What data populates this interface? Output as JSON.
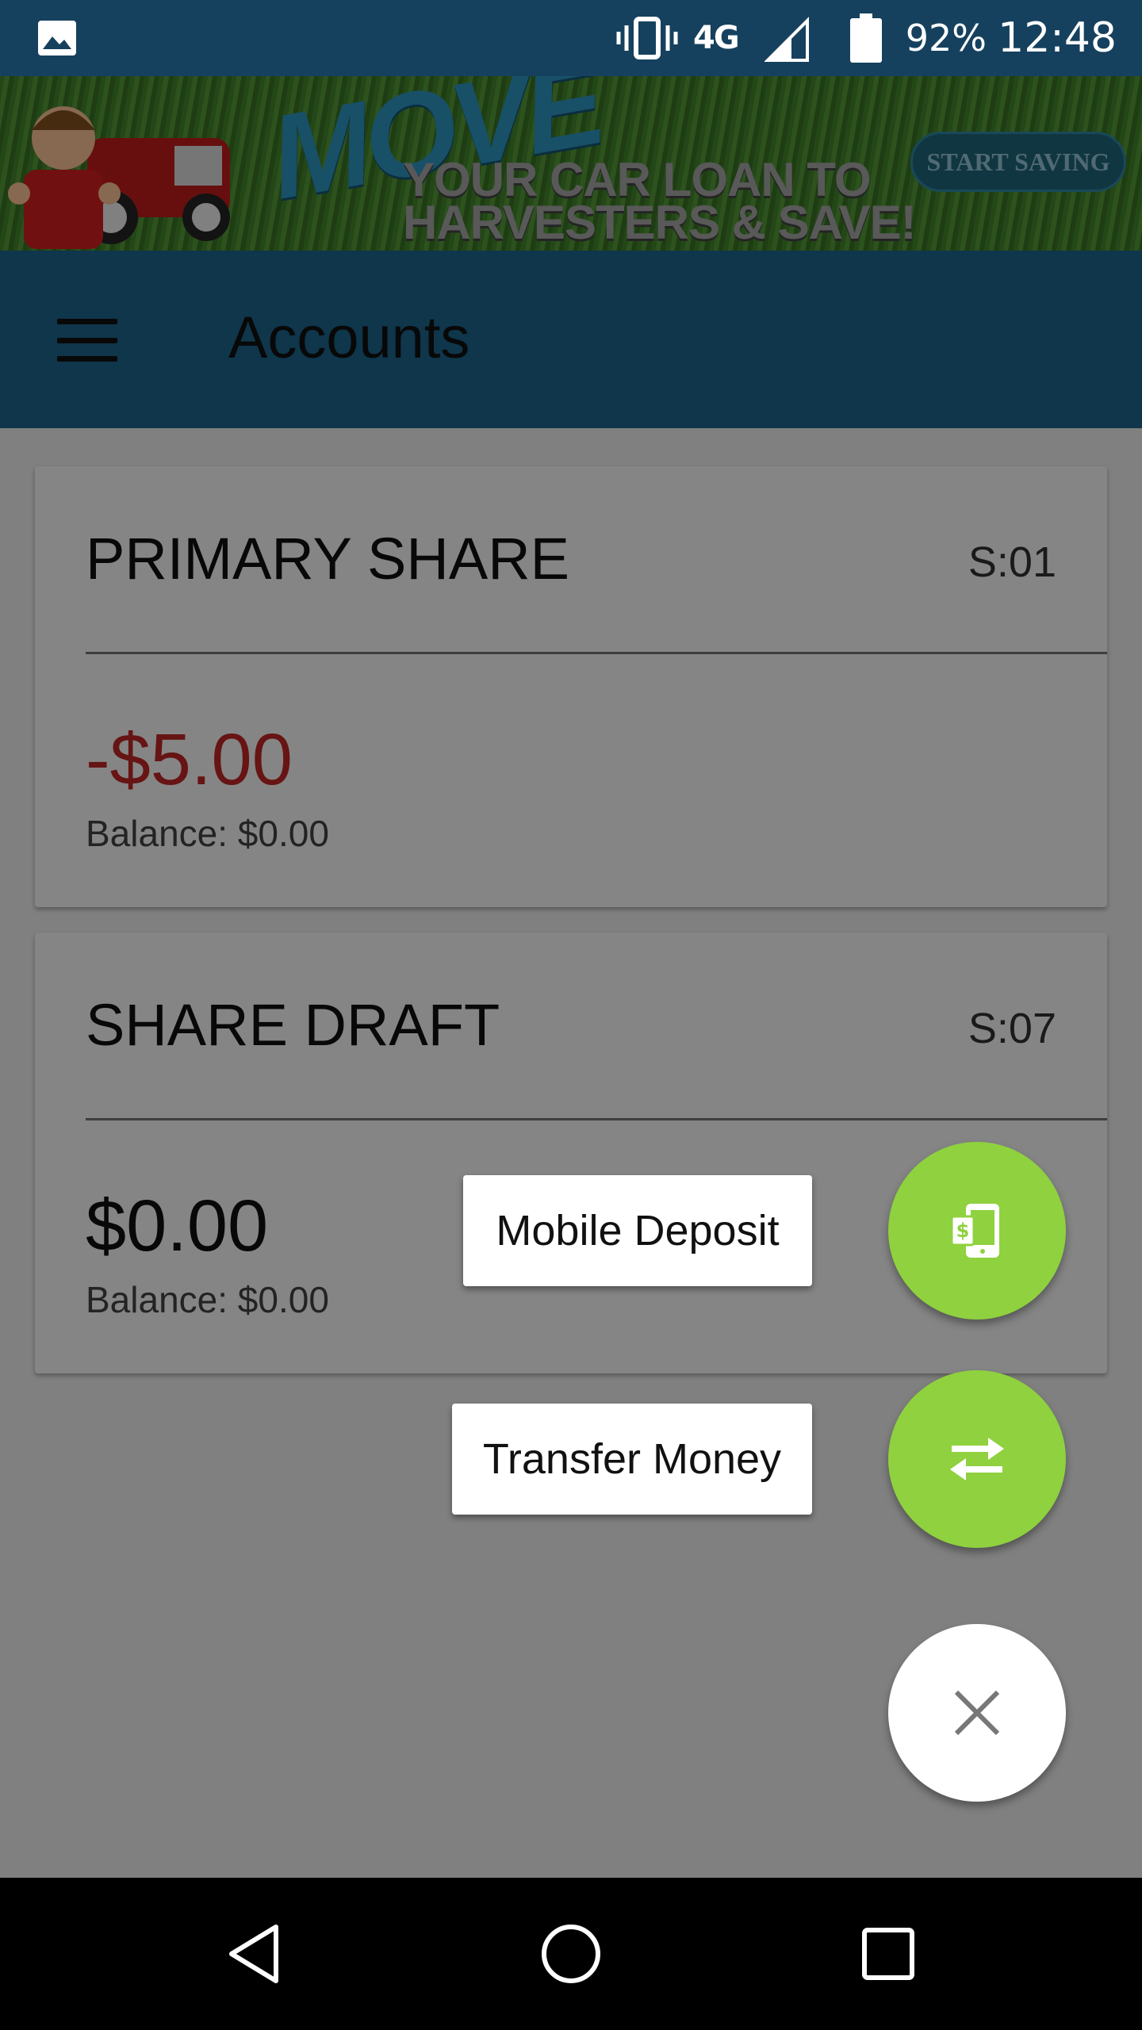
{
  "status_bar": {
    "network": "4G",
    "battery": "92%",
    "time": "12:48",
    "icons": [
      "image-icon",
      "vibrate-icon",
      "lte-icon",
      "signal-icon",
      "battery-icon"
    ]
  },
  "ad_banner": {
    "headline": "MOVE",
    "line1": "YOUR CAR LOAN TO",
    "line2": "HARVESTERS & SAVE!",
    "cta": "START SAVING"
  },
  "app_bar": {
    "title": "Accounts",
    "menu_icon": "hamburger-menu-icon"
  },
  "accounts": [
    {
      "name": "PRIMARY SHARE",
      "code": "S:01",
      "amount": "-$5.00",
      "amount_color": "#c62828",
      "balance": "Balance: $0.00"
    },
    {
      "name": "SHARE DRAFT",
      "code": "S:07",
      "amount": "$0.00",
      "amount_color": "#111111",
      "balance": "Balance: $0.00"
    }
  ],
  "fab_menu": {
    "deposit_label": "Mobile Deposit",
    "transfer_label": "Transfer Money",
    "deposit_icon": "mobile-deposit-icon",
    "transfer_icon": "transfer-arrows-icon",
    "close_icon": "close-icon",
    "accent_color": "#8fd13f"
  },
  "nav_bar": {
    "icons": [
      "back-icon",
      "home-icon",
      "recents-icon"
    ]
  },
  "colors": {
    "status_bar": "#16415e",
    "app_bar": "#1e6891",
    "scrim": "rgba(0,0,0,0.48)"
  }
}
